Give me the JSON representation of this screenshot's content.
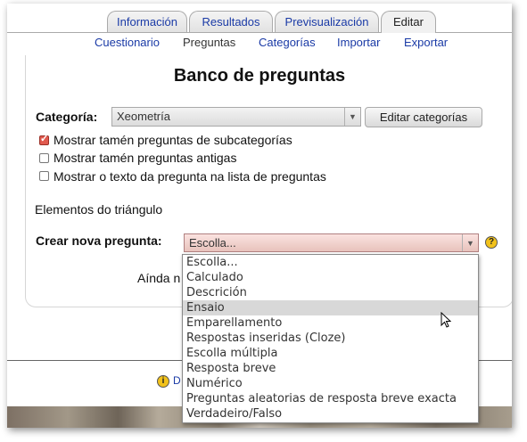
{
  "tabs": [
    {
      "label": "Información"
    },
    {
      "label": "Resultados"
    },
    {
      "label": "Previsualización"
    },
    {
      "label": "Editar"
    }
  ],
  "subtabs": [
    {
      "label": "Cuestionario"
    },
    {
      "label": "Preguntas"
    },
    {
      "label": "Categorías"
    },
    {
      "label": "Importar"
    },
    {
      "label": "Exportar"
    }
  ],
  "page_title": "Banco de preguntas",
  "category": {
    "label": "Categoría:",
    "selected": "Xeometría",
    "edit_button": "Editar categorías"
  },
  "options": [
    {
      "label": "Mostrar tamén preguntas de subcategorías",
      "checked": true
    },
    {
      "label": "Mostrar tamén preguntas antigas",
      "checked": false
    },
    {
      "label": "Mostrar o texto da pregunta na lista de preguntas",
      "checked": false
    }
  ],
  "category_name": "Elementos do triángulo",
  "create": {
    "label": "Crear nova pregunta:",
    "selected": "Escolla...",
    "help_icon": "?",
    "options": [
      "Escolla...",
      "Calculado",
      "Descrición",
      "Ensaio",
      "Emparellamento",
      "Respostas inseridas (Cloze)",
      "Escolla múltipla",
      "Resposta breve",
      "Numérico",
      "Preguntas aleatorias de resposta breve exacta",
      "Verdadeiro/Falso"
    ],
    "highlighted_index": 3
  },
  "partial_text": "Aínda n",
  "footer_link_partial": "D",
  "footer_icon": "i",
  "colors": {
    "link": "#1a3aa6",
    "dropdown_highlight": "#d8d8d8",
    "open_select": "#f0cfca"
  }
}
